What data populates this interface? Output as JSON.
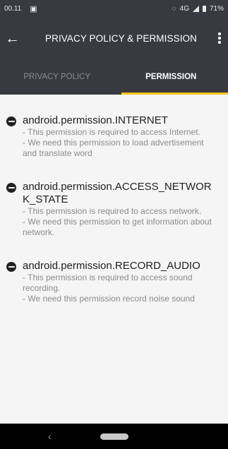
{
  "status_bar": {
    "time": "00.11",
    "notification_icon": "lock-notification-icon",
    "network": "4G",
    "battery": "71%"
  },
  "app_bar": {
    "back_icon": "arrow-left-icon",
    "title": "PRIVACY POLICY & PERMISSION",
    "menu_icon": "more-vertical-icon"
  },
  "tabs": [
    {
      "label": "PRIVACY POLICY",
      "active": false
    },
    {
      "label": "PERMISSION",
      "active": true
    }
  ],
  "accent_color": "#f8c21c",
  "permissions": [
    {
      "name": "android.permission.INTERNET",
      "requirement": "- This permission is required to access Internet.",
      "reason": "- We need this permission to load advertisement and translate word"
    },
    {
      "name": "android.permission.ACCESS_NETWORK_STATE",
      "requirement": "- This permission is required to access network.",
      "reason": "- We need this permission to get information about network."
    },
    {
      "name": "android.permission.RECORD_AUDIO",
      "requirement": "- This permission is required to access sound recording.",
      "reason": "- We need this permission record noise sound"
    }
  ],
  "nav_bar": {
    "back_icon": "nav-back-icon",
    "home_icon": "nav-home-pill-icon"
  }
}
